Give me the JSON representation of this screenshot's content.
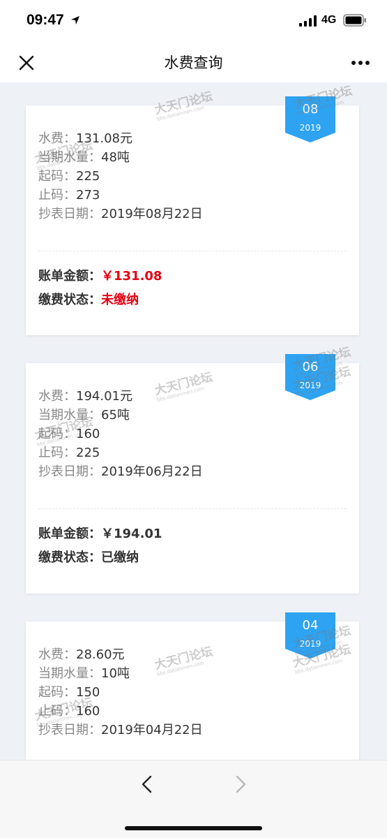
{
  "status_bar": {
    "time": "09:47",
    "network": "4G",
    "icons": [
      "location-arrow-icon",
      "signal-icon",
      "battery-icon"
    ]
  },
  "nav": {
    "title": "水费查询",
    "close_icon": "close-icon",
    "more_icon": "more-dots-icon"
  },
  "colors": {
    "ribbon": "#2ea3f2",
    "unpaid": "#e60012",
    "background": "#eef1f6"
  },
  "labels": {
    "fee": "水费：",
    "usage": "当期水量：",
    "start_reading": "起码：",
    "end_reading": "止码：",
    "read_date": "抄表日期：",
    "bill_amount": "账单金额：",
    "pay_status": "缴费状态："
  },
  "bills": [
    {
      "month": "08",
      "year": "2019",
      "fee": "131.08元",
      "usage": "48吨",
      "start_reading": "225",
      "end_reading": "273",
      "read_date": "2019年08月22日",
      "amount": "￥131.08",
      "status": "未缴纳"
    },
    {
      "month": "06",
      "year": "2019",
      "fee": "194.01元",
      "usage": "65吨",
      "start_reading": "160",
      "end_reading": "225",
      "read_date": "2019年06月22日",
      "amount": "￥194.01",
      "status": "已缴纳"
    },
    {
      "month": "04",
      "year": "2019",
      "fee": "28.60元",
      "usage": "10吨",
      "start_reading": "150",
      "end_reading": "160",
      "read_date": "2019年04月22日"
    }
  ],
  "watermark": {
    "text": "大天门论坛",
    "url": "bbs.datianmen.com"
  },
  "browser_nav": {
    "back_icon": "chevron-left-icon",
    "forward_icon": "chevron-right-icon"
  }
}
